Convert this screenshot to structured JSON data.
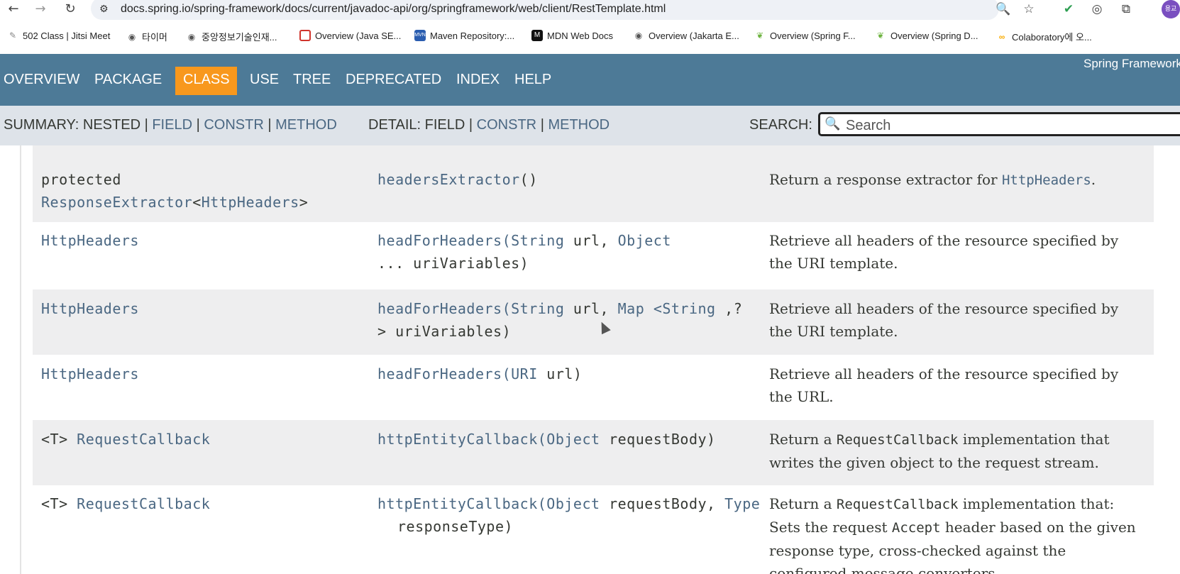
{
  "browser": {
    "url": "docs.spring.io/spring-framework/docs/current/javadoc-api/org/springframework/web/client/RestTemplate.html",
    "profile_initials": "용교"
  },
  "bookmarks": [
    {
      "label": "502 Class | Jitsi Meet",
      "icon": "jitsi-icon"
    },
    {
      "label": "타이머",
      "icon": "globe-icon"
    },
    {
      "label": "중앙정보기술인재...",
      "icon": "globe-icon"
    },
    {
      "label": "Overview (Java SE...",
      "icon": "oracle-icon"
    },
    {
      "label": "Maven Repository:...",
      "icon": "mvn-icon"
    },
    {
      "label": "MDN Web Docs",
      "icon": "mdn-icon"
    },
    {
      "label": "Overview (Jakarta E...",
      "icon": "globe-icon"
    },
    {
      "label": "Overview (Spring F...",
      "icon": "spring-icon"
    },
    {
      "label": "Overview (Spring D...",
      "icon": "spring-icon"
    },
    {
      "label": "Colaboratory에 오...",
      "icon": "colab-icon"
    }
  ],
  "topnav": {
    "items": [
      "OVERVIEW",
      "PACKAGE",
      "CLASS",
      "USE",
      "TREE",
      "DEPRECATED",
      "INDEX",
      "HELP"
    ],
    "active": "CLASS",
    "brand": "Spring Framework"
  },
  "subnav": {
    "summary_label": "SUMMARY:",
    "summary_nested": "NESTED",
    "summary_field": "FIELD",
    "summary_constr": "CONSTR",
    "summary_method": "METHOD",
    "detail_label": "DETAIL:",
    "detail_field": "FIELD",
    "detail_constr": "CONSTR",
    "detail_method": "METHOD",
    "sep": "|",
    "search_label": "SEARCH:",
    "search_placeholder": "Search"
  },
  "methods": [
    {
      "mod_prefix": "protected",
      "type": "ResponseExtractor",
      "type_generic_open": "<",
      "type_arg": "HttpHeaders",
      "type_generic_close": ">",
      "name": "headersExtractor",
      "sig_rest": "()",
      "desc_pre": "Return a response extractor for ",
      "desc_code": "HttpHeaders",
      "desc_post": "."
    },
    {
      "type": "HttpHeaders",
      "name": "headForHeaders",
      "sig_open": "(",
      "p1_type": "String",
      "p1_name": "url, ",
      "p2_type": "Object",
      "line2": "... uriVariables)",
      "desc_line1": "Retrieve all headers of the resource specified by",
      "desc_line2": "the URI template."
    },
    {
      "type": "HttpHeaders",
      "name": "headForHeaders",
      "sig_open": "(",
      "p1_type": "String",
      "p1_name": "url, ",
      "p2_type": "Map",
      "p2_generic": "<String",
      "p2_tail": " ,?",
      "line2": "> uriVariables)",
      "desc_line1": "Retrieve all headers of the resource specified by",
      "desc_line2": "the URI template."
    },
    {
      "type": "HttpHeaders",
      "name": "headForHeaders",
      "sig_open": "(",
      "p1_type": "URI",
      "p1_name": "url)",
      "desc_line1": "Retrieve all headers of the resource specified by",
      "desc_line2": "the URL."
    },
    {
      "type_prefix": "<T>",
      "type": "RequestCallback",
      "name": "httpEntityCallback",
      "sig_open": "(",
      "p1_type": "Object",
      "p1_name": "requestBody)",
      "desc_pre": "Return a ",
      "desc_code": "RequestCallback",
      "desc_post": " implementation that",
      "desc_line2": "writes the given object to the request stream."
    },
    {
      "type_prefix": "<T>",
      "type": "RequestCallback",
      "name": "httpEntityCallback",
      "sig_open": "(",
      "p1_type": "Object",
      "p1_name": "requestBody, ",
      "p2_type": "Type",
      "line2": "responseType)",
      "desc_pre": "Return a ",
      "desc_code": "RequestCallback",
      "desc_post": " implementation that:",
      "desc_l2_pre": "Sets the request ",
      "desc_l2_code": "Accept",
      "desc_l2_post": " header based on the given",
      "desc_line3": "response type, cross-checked against the",
      "desc_line4": "configured message converters."
    }
  ]
}
